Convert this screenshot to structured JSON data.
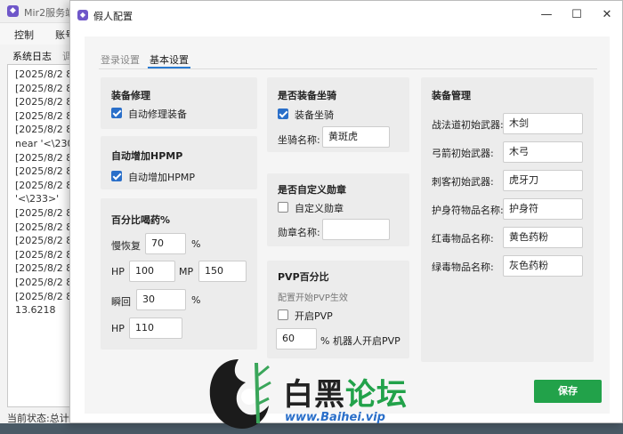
{
  "background_window": {
    "title": "Mir2服务端",
    "menu": [
      "控制",
      "账号"
    ],
    "tabs": [
      "系统日志",
      "调"
    ],
    "log_lines": [
      "[2025/8/2 8:",
      "[2025/8/2 8:",
      "[2025/8/2 8:",
      "[2025/8/2 8:",
      "[2025/8/2 8:",
      "near '<\\230",
      "[2025/8/2 8:",
      "[2025/8/2 8:",
      "[2025/8/2 8:",
      "'<\\233>'",
      "[2025/8/2 8:",
      "[2025/8/2 8:",
      "[2025/8/2 8:",
      "[2025/8/2 8:",
      "[2025/8/2 8:",
      "[2025/8/2 8:",
      "[2025/8/2 8:",
      "13.6218"
    ],
    "status": "当前状态:总计:"
  },
  "dialog": {
    "title": "假人配置",
    "controls": {
      "minimize": "—",
      "maximize": "☐",
      "close": "✕"
    },
    "tabs": [
      {
        "label": "登录设置",
        "active": false
      },
      {
        "label": "基本设置",
        "active": true
      }
    ],
    "equip_repair": {
      "title": "装备修理",
      "checkbox_label": "自动修理装备",
      "checked": true
    },
    "auto_hpmp": {
      "title": "自动增加HPMP",
      "checkbox_label": "自动增加HPMP",
      "checked": true
    },
    "potion_percent": {
      "title": "百分比喝药%",
      "slow_label": "慢恢复",
      "slow_value": "70",
      "slow_unit": "%",
      "hp_label": "HP",
      "hp_value": "100",
      "mp_label": "MP",
      "mp_value": "150",
      "instant_label": "瞬回",
      "instant_value": "30",
      "instant_unit": "%",
      "hp2_label": "HP",
      "hp2_value": "110"
    },
    "mount": {
      "title": "是否装备坐骑",
      "checkbox_label": "装备坐骑",
      "checked": true,
      "name_label": "坐骑名称:",
      "name_value": "黄斑虎"
    },
    "medal": {
      "title": "是否自定义勋章",
      "checkbox_label": "自定义勋章",
      "checked": false,
      "name_label": "勋章名称:",
      "name_value": ""
    },
    "pvp": {
      "title": "PVP百分比",
      "desc": "配置开始PVP生效",
      "checkbox_label": "开启PVP",
      "checked": false,
      "value": "60",
      "suffix": "% 机器人开启PVP"
    },
    "equip_manage": {
      "title": "装备管理",
      "rows": [
        {
          "label": "战法道初始武器:",
          "value": "木剑"
        },
        {
          "label": "弓箭初始武器:",
          "value": "木弓"
        },
        {
          "label": "刺客初始武器:",
          "value": "虎牙刀"
        },
        {
          "label": "护身符物品名称:",
          "value": "护身符"
        },
        {
          "label": "红毒物品名称:",
          "value": "黄色药粉"
        },
        {
          "label": "绿毒物品名称:",
          "value": "灰色药粉"
        }
      ]
    },
    "save_label": "保存"
  },
  "watermark": {
    "text_main": "白黑",
    "text_accent": "论坛",
    "url": "www.Baihei.vip"
  },
  "colors": {
    "accent_blue": "#2a6fc9",
    "save_green": "#22a24a",
    "card_bg": "#ececec"
  }
}
